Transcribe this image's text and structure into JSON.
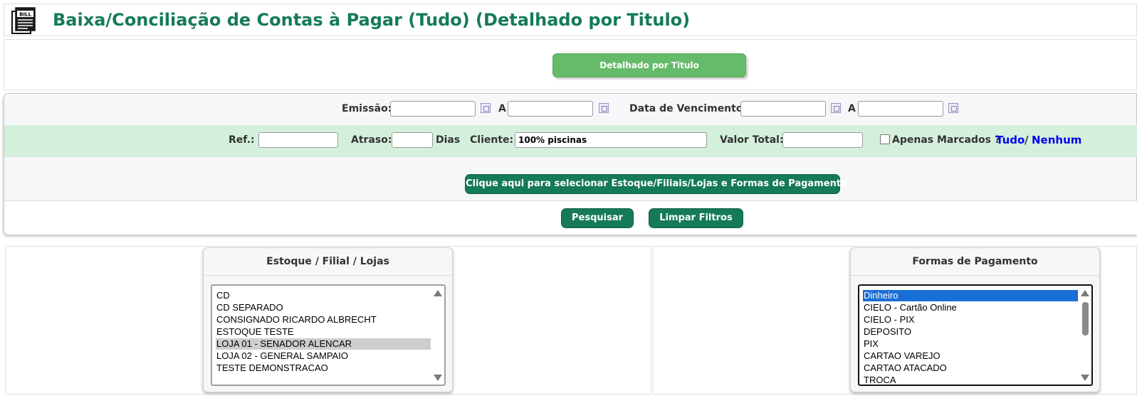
{
  "header": {
    "title": "Baixa/Conciliação de Contas à Pagar (Tudo) (Detalhado por Titulo)",
    "icon": "bill-document-icon",
    "icon_text": "BILL"
  },
  "mode": {
    "button_label": "Detalhado por Titulo"
  },
  "filters": {
    "emissao_label": "Emissão:",
    "emissao_start": "",
    "range_sep_1": "A",
    "emissao_end": "",
    "vencimento_label": "Data de Vencimento:",
    "vencimento_start": "",
    "range_sep_2": "A",
    "vencimento_end": "",
    "ref_label": "Ref.:",
    "ref_value": "",
    "atraso_label": "Atraso:",
    "atraso_value": "",
    "dias_label": "Dias",
    "cliente_label": "Cliente:",
    "cliente_value": "100% piscinas",
    "valor_total_label": "Valor Total:",
    "valor_total_value": "",
    "apenas_marcados_label": "Apenas Marcados ?",
    "apenas_marcados_checked": false,
    "tudo_link": "Tudo",
    "link_sep": "/",
    "nenhum_link": "Nenhum",
    "select_button": "Clique aqui para selecionar Estoque/Filiais/Lojas e Formas de Pagamento",
    "search_button": "Pesquisar",
    "clear_button": "Limpar Filtros"
  },
  "stores": {
    "title": "Estoque / Filial / Lojas",
    "items": [
      {
        "label": "CD",
        "state": "normal"
      },
      {
        "label": "CD SEPARADO",
        "state": "normal"
      },
      {
        "label": "CONSIGNADO RICARDO ALBRECHT",
        "state": "normal"
      },
      {
        "label": "ESTOQUE TESTE",
        "state": "normal"
      },
      {
        "label": "LOJA 01 - SENADOR ALENCAR",
        "state": "selected-inactive"
      },
      {
        "label": "LOJA 02 - GENERAL SAMPAIO",
        "state": "normal"
      },
      {
        "label": "TESTE DEMONSTRACAO",
        "state": "normal"
      }
    ]
  },
  "payments": {
    "title": "Formas de Pagamento",
    "items": [
      {
        "label": "Dinheiro",
        "state": "selected-active"
      },
      {
        "label": "CIELO - Cartão Online",
        "state": "normal"
      },
      {
        "label": "CIELO - PIX",
        "state": "normal"
      },
      {
        "label": "DEPOSITO",
        "state": "normal"
      },
      {
        "label": "PIX",
        "state": "normal"
      },
      {
        "label": "CARTAO VAREJO",
        "state": "normal"
      },
      {
        "label": "CARTAO ATACADO",
        "state": "normal"
      },
      {
        "label": "TROCA",
        "state": "normal"
      }
    ]
  },
  "colors": {
    "title_green": "#157a5a",
    "mode_button_green": "#66bb6a",
    "dark_button_green": "#157a5a",
    "filter_row_green": "#d4f0dc",
    "link_blue": "#0000ee",
    "selection_blue": "#1a6fd6",
    "selection_grey": "#cecece"
  }
}
